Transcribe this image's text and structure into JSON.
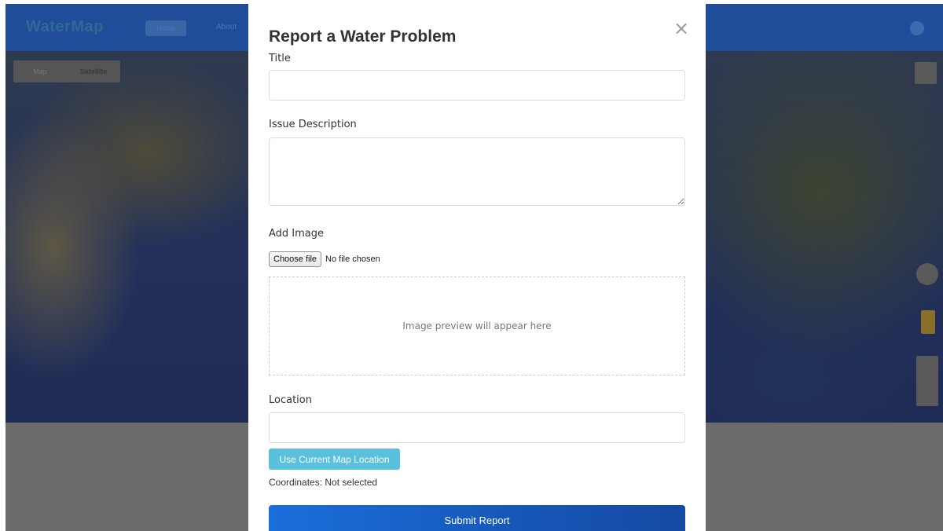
{
  "background": {
    "brand": "WaterMap",
    "nav_pill": "Home",
    "nav_link": "About",
    "map_toggle": [
      "Map",
      "Satellite"
    ]
  },
  "modal": {
    "title": "Report a Water Problem",
    "close_glyph": "×",
    "title_label": "Title",
    "title_value": "",
    "description_label": "Issue Description",
    "description_value": "",
    "image_label": "Add Image",
    "choose_file_label": "Choose file",
    "file_status": "No file chosen",
    "preview_text": "Image preview will appear here",
    "location_label": "Location",
    "location_value": "",
    "use_location_label": "Use Current Map Location",
    "coordinates_text": "Coordinates: Not selected",
    "submit_label": "Submit Report"
  },
  "colors": {
    "navbar": "#1f4d99",
    "info_button": "#5bc0de",
    "primary_button": "#1a6fdc"
  }
}
